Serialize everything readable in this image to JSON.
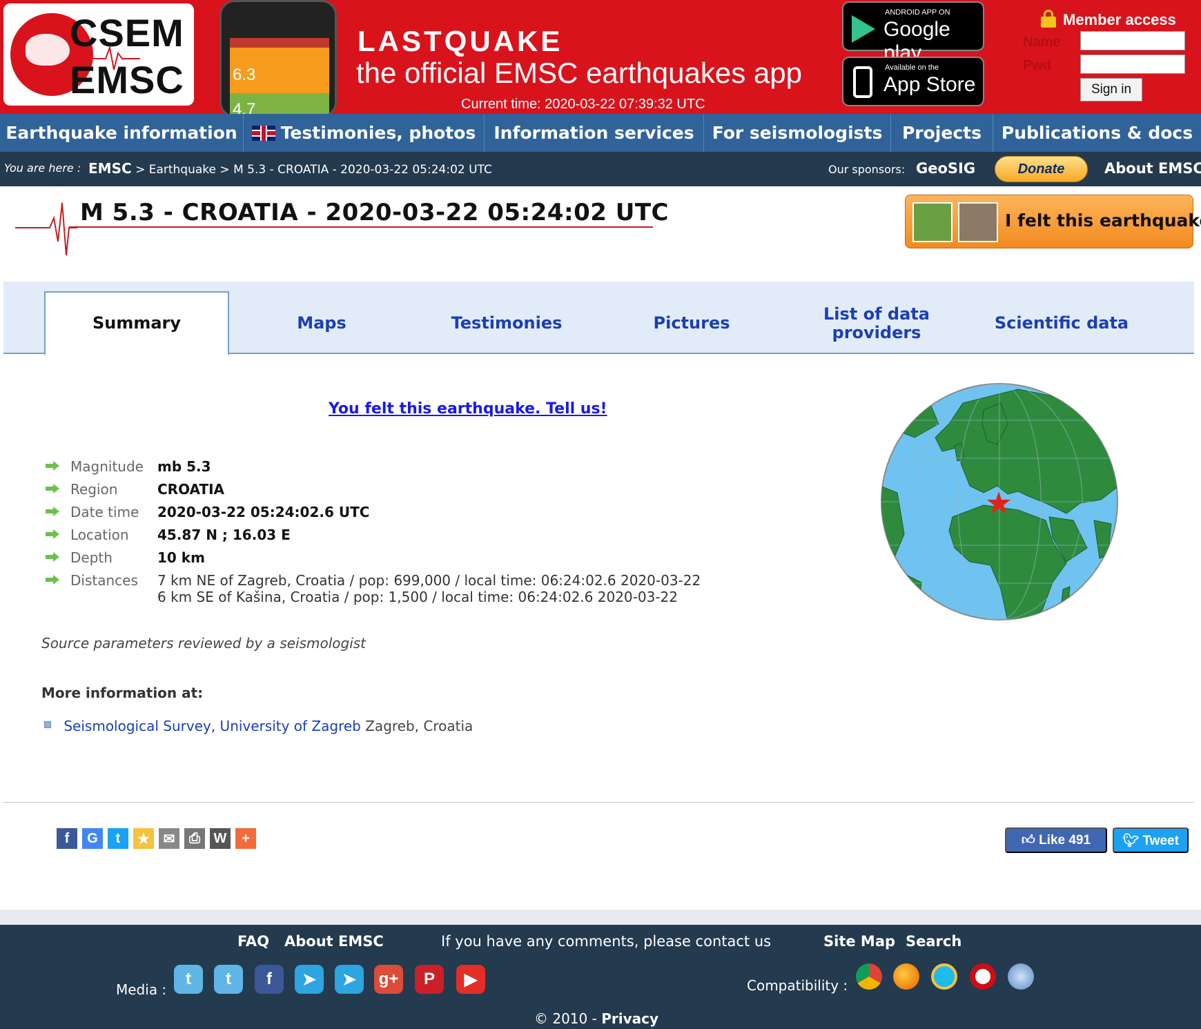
{
  "header": {
    "logo_line1": "CSEM",
    "logo_line2": "EMSC",
    "phone_value1": "6.3",
    "phone_value2": "4.7",
    "app_title": "LASTQUAKE",
    "app_subtitle": "the official EMSC earthquakes app",
    "current_time": "Current time: 2020-03-22 07:39:32 UTC",
    "google_play_small": "ANDROID APP ON",
    "google_play_big": "Google play",
    "app_store_small": "Available on the",
    "app_store_big": "App Store",
    "member_access": "Member access",
    "name_label": "Name",
    "pwd_label": "Pwd",
    "sign_in": "Sign in"
  },
  "nav": {
    "items": [
      "Earthquake information",
      "Testimonies, photos",
      "Information services",
      "For seismologists",
      "Projects",
      "Publications & docs"
    ]
  },
  "breadcrumb": {
    "here": "You are here :",
    "root": "EMSC",
    "sep": ">",
    "level1": "Earthquake",
    "level2": "M 5.3 - CROATIA - 2020-03-22 05:24:02 UTC",
    "sponsors_label": "Our sponsors:",
    "sponsor": "GeoSIG",
    "donate": "Donate",
    "about": "About EMSC"
  },
  "event": {
    "title": "M 5.3 - CROATIA - 2020-03-22 05:24:02 UTC",
    "felt_button": "I felt this earthquake"
  },
  "tabs": {
    "summary": "Summary",
    "maps": "Maps",
    "testimonies": "Testimonies",
    "pictures": "Pictures",
    "providers_1": "List of data",
    "providers_2": "providers",
    "scientific": "Scientific data"
  },
  "summary": {
    "felt_link": "You felt this earthquake. Tell us!",
    "magnitude_label": "Magnitude",
    "magnitude": "mb 5.3",
    "region_label": "Region",
    "region": "CROATIA",
    "datetime_label": "Date time",
    "datetime": "2020-03-22 05:24:02.6 UTC",
    "location_label": "Location",
    "location": "45.87 N ; 16.03 E",
    "depth_label": "Depth",
    "depth": "10 km",
    "distances_label": "Distances",
    "distance1": "7 km NE of Zagreb, Croatia / pop: 699,000 / local time: 06:24:02.6 2020-03-22",
    "distance2": "6 km SE of Kašina, Croatia / pop: 1,500 / local time: 06:24:02.6 2020-03-22",
    "source": "Source parameters reviewed by a seismologist",
    "more_info": "More information at:",
    "more_link": "Seismological Survey, University of Zagreb",
    "more_place": "Zagreb, Croatia"
  },
  "social": {
    "like": "Like 491",
    "tweet": "Tweet"
  },
  "footer": {
    "faq": "FAQ",
    "about": "About EMSC",
    "comments": "If you have any comments, please contact us",
    "sitemap": "Site Map",
    "search": "Search",
    "media": "Media :",
    "compatibility": "Compatibility :",
    "copyright": "© 2010 -",
    "privacy": "Privacy"
  },
  "colors": {
    "header_red": "#d8131c",
    "nav_blue": "#2f6399",
    "dark_bar": "#243a4e",
    "tab_bg": "#e2ebf8",
    "link_blue": "#1a3fb3",
    "ocean": "#6ec3f0",
    "land": "#2e8b3e",
    "epicenter": "#e2231a"
  },
  "icons": {
    "share": [
      "facebook-icon",
      "google-icon",
      "twitter-icon",
      "favorite-icon",
      "email-icon",
      "print-icon",
      "wordpress-icon",
      "more-icon"
    ],
    "media": [
      "twitter-icon",
      "twitter-icon",
      "facebook-icon",
      "telegram-icon",
      "telegram-icon",
      "google-plus-icon",
      "pinterest-icon",
      "youtube-icon"
    ],
    "browsers": [
      "chrome-icon",
      "firefox-icon",
      "ie-icon",
      "opera-icon",
      "safari-icon"
    ]
  }
}
